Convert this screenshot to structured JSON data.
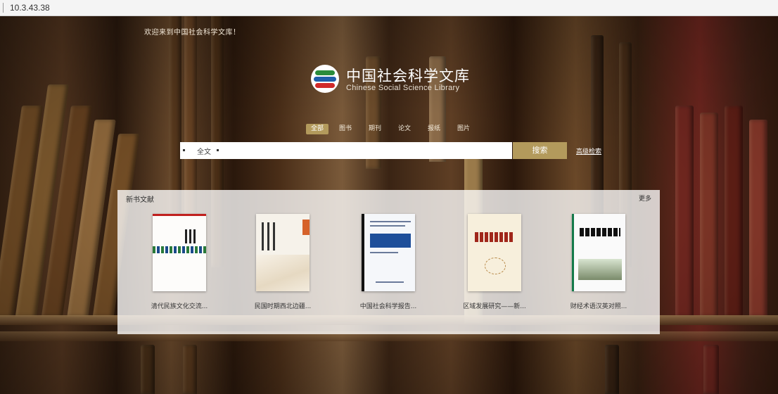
{
  "browser": {
    "url": "10.3.43.38"
  },
  "header": {
    "welcome": "欢迎来到中国社会科学文库！",
    "logo_cn": "中国社会科学文库",
    "logo_en": "Chinese Social Science Library"
  },
  "nav": {
    "tabs": [
      {
        "label": "全部",
        "active": true
      },
      {
        "label": "图书",
        "active": false
      },
      {
        "label": "期刊",
        "active": false
      },
      {
        "label": "论文",
        "active": false
      },
      {
        "label": "报纸",
        "active": false
      },
      {
        "label": "图片",
        "active": false
      }
    ]
  },
  "search": {
    "scope": "全文",
    "placeholder": "",
    "button_label": "搜索",
    "advanced_label": "高级检索"
  },
  "featured": {
    "title": "新书文献",
    "more_label": "更多",
    "books": [
      {
        "caption": "清代民族文化交流..."
      },
      {
        "caption": "民国时期西北边疆..."
      },
      {
        "caption": "中国社会科学报告..."
      },
      {
        "caption": "区域发展研究——新..."
      },
      {
        "caption": "财经术语汉英对照..."
      }
    ]
  },
  "colors": {
    "accent": "#b39a5c",
    "panel": "rgba(255,255,255,0.78)"
  }
}
